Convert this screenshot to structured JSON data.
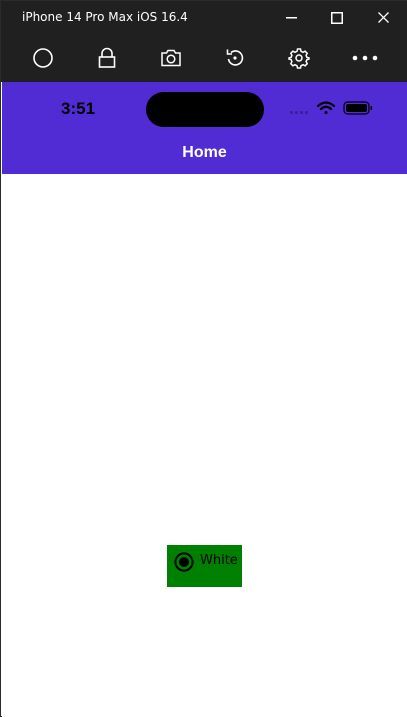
{
  "window": {
    "title": "iPhone 14 Pro Max iOS 16.4"
  },
  "toolbar": {
    "icons": [
      "home-circle-icon",
      "lock-icon",
      "camera-icon",
      "rotate-icon",
      "settings-gear-icon",
      "more-icon"
    ]
  },
  "status_bar": {
    "time": "3:51"
  },
  "nav": {
    "title": "Home"
  },
  "radio": {
    "label": "White",
    "checked": true
  },
  "colors": {
    "header": "#512bd4",
    "radio_background": "#008000",
    "titlebar": "#202020"
  }
}
